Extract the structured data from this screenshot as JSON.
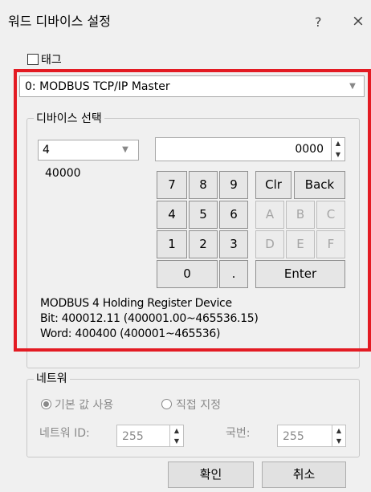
{
  "window": {
    "title": "워드 디바이스 설정",
    "help": "?",
    "close": "×"
  },
  "tag": {
    "label": "태그",
    "checked": false
  },
  "protocol": {
    "value": "0: MODBUS TCP/IP Master"
  },
  "device_select": {
    "legend": "디바이스 선택",
    "device_type": "4",
    "address_value": "0000",
    "base_address": "40000",
    "keypad": {
      "digits": [
        "7",
        "8",
        "9",
        "4",
        "5",
        "6",
        "1",
        "2",
        "3"
      ],
      "zero": "0",
      "dot": ".",
      "clr": "Clr",
      "back": "Back",
      "hex": [
        "A",
        "B",
        "C",
        "D",
        "E",
        "F"
      ],
      "enter": "Enter"
    },
    "info_line1": "MODBUS 4 Holding Register Device",
    "info_line2": "Bit: 400012.11 (400001.00~465536.15)",
    "info_line3": "Word: 400400 (400001~465536)"
  },
  "network": {
    "legend": "네트워",
    "opt_default": "기본 값 사용",
    "opt_direct": "직접 지정",
    "id_label": "네트워 ID:",
    "id_value": "255",
    "station_label": "국번:",
    "station_value": "255"
  },
  "buttons": {
    "ok": "확인",
    "cancel": "취소"
  },
  "colors": {
    "highlight": "#e31b23",
    "background": "#f0f0f0"
  }
}
